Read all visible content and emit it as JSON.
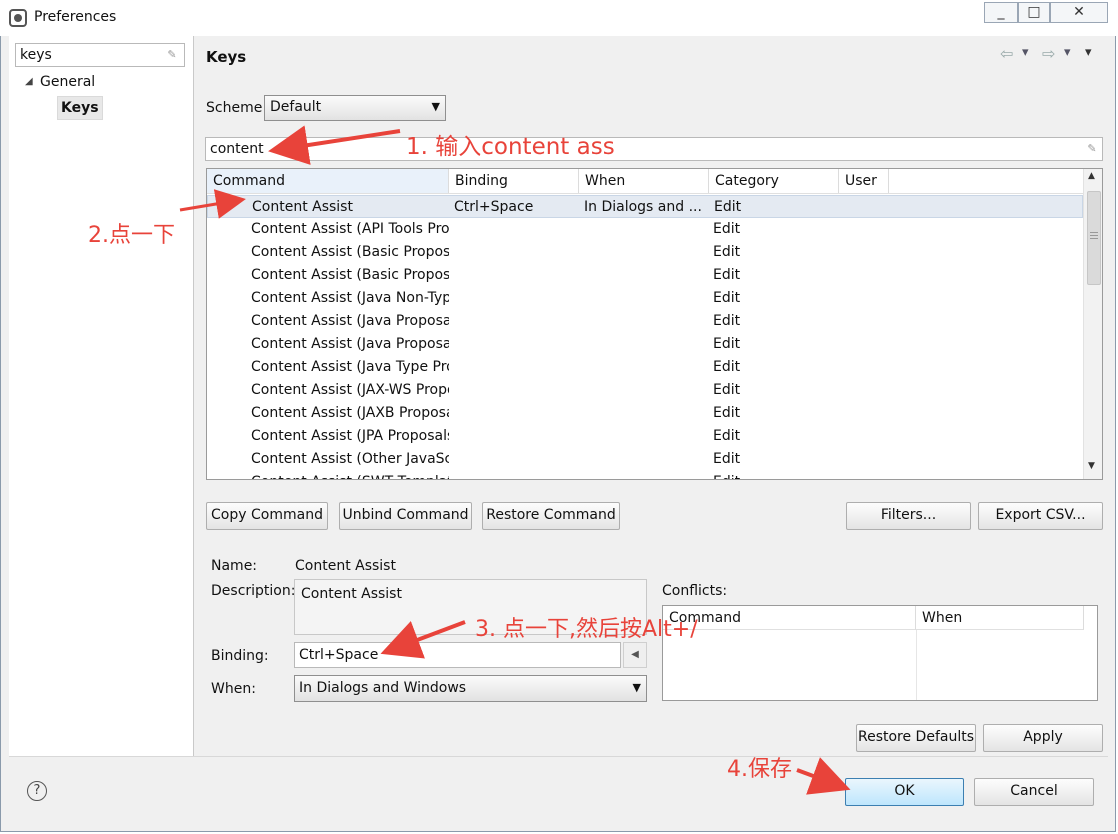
{
  "window": {
    "title": "Preferences",
    "controls": [
      "_",
      "□",
      "✕"
    ]
  },
  "left": {
    "filter_value": "keys",
    "tree": [
      {
        "label": "General",
        "expanded": true
      },
      {
        "label": "Keys",
        "selected": true
      }
    ]
  },
  "header": {
    "title": "Keys",
    "nav_back": "⇦",
    "nav_forward": "⇨",
    "menu": "▾"
  },
  "scheme": {
    "label": "Scheme:",
    "value": "Default"
  },
  "filter_text": "content",
  "table": {
    "columns": [
      "Command",
      "Binding",
      "When",
      "Category",
      "User"
    ],
    "rows": [
      {
        "command": "Content Assist",
        "binding": "Ctrl+Space",
        "when": "In Dialogs and ...",
        "category": "Edit",
        "user": ""
      },
      {
        "command": "Content Assist (API Tools Prop",
        "binding": "",
        "when": "",
        "category": "Edit",
        "user": ""
      },
      {
        "command": "Content Assist (Basic Proposal",
        "binding": "",
        "when": "",
        "category": "Edit",
        "user": ""
      },
      {
        "command": "Content Assist (Basic Proposal",
        "binding": "",
        "when": "",
        "category": "Edit",
        "user": ""
      },
      {
        "command": "Content Assist (Java Non-Type",
        "binding": "",
        "when": "",
        "category": "Edit",
        "user": ""
      },
      {
        "command": "Content Assist (Java Proposals",
        "binding": "",
        "when": "",
        "category": "Edit",
        "user": ""
      },
      {
        "command": "Content Assist (Java Proposals",
        "binding": "",
        "when": "",
        "category": "Edit",
        "user": ""
      },
      {
        "command": "Content Assist (Java Type Prop",
        "binding": "",
        "when": "",
        "category": "Edit",
        "user": ""
      },
      {
        "command": "Content Assist (JAX-WS Propo",
        "binding": "",
        "when": "",
        "category": "Edit",
        "user": ""
      },
      {
        "command": "Content Assist (JAXB Proposal",
        "binding": "",
        "when": "",
        "category": "Edit",
        "user": ""
      },
      {
        "command": "Content Assist (JPA Proposals)",
        "binding": "",
        "when": "",
        "category": "Edit",
        "user": ""
      },
      {
        "command": "Content Assist (Other JavaScri",
        "binding": "",
        "when": "",
        "category": "Edit",
        "user": ""
      },
      {
        "command": "Content Assist (SWT Templat",
        "binding": "",
        "when": "",
        "category": "Edit",
        "user": ""
      }
    ]
  },
  "buttons": {
    "copy": "Copy Command",
    "unbind": "Unbind Command",
    "restore_cmd": "Restore Command",
    "filters": "Filters...",
    "export": "Export CSV...",
    "restore_defaults": "Restore Defaults",
    "apply": "Apply",
    "ok": "OK",
    "cancel": "Cancel"
  },
  "details": {
    "name_label": "Name:",
    "name_value": "Content Assist",
    "desc_label": "Description:",
    "desc_value": "Content Assist",
    "binding_label": "Binding:",
    "binding_value": "Ctrl+Space",
    "when_label": "When:",
    "when_value": "In Dialogs and Windows"
  },
  "conflicts": {
    "label": "Conflicts:",
    "columns": [
      "Command",
      "When"
    ]
  },
  "help_icon": "?",
  "annotations": {
    "a1": "1. 输入content ass",
    "a2": "2.点一下",
    "a3": "3. 点一下,然后按Alt+/",
    "a4": "4.保存"
  },
  "colors": {
    "annotation": "#e8433a",
    "selected_row": "#e4eaf2",
    "ok_border": "#3c7fb1"
  }
}
